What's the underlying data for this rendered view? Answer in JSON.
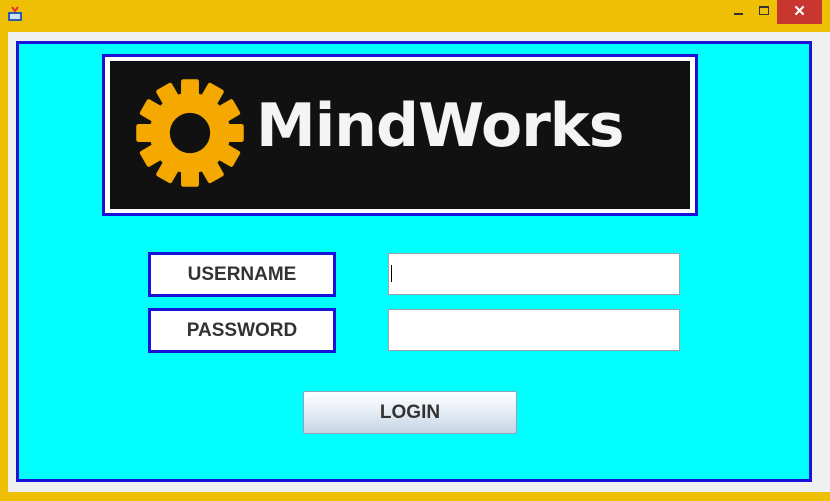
{
  "window": {
    "icon": "java-app-icon",
    "controls": {
      "minimize_icon": "minimize-icon",
      "maximize_icon": "maximize-icon",
      "close_icon": "close-icon",
      "close_glyph": "✕"
    },
    "frame_color": "#efbf05"
  },
  "logo": {
    "brand_text": "MindWorks",
    "gear_color": "#f5a800",
    "background": "#111111"
  },
  "form": {
    "username_label": "USERNAME",
    "password_label": "PASSWORD",
    "username_value": "",
    "password_value": "",
    "login_label": "LOGIN"
  },
  "colors": {
    "panel_background": "#00ffff",
    "panel_border": "#1a12d8",
    "close_button": "#c7372f"
  }
}
